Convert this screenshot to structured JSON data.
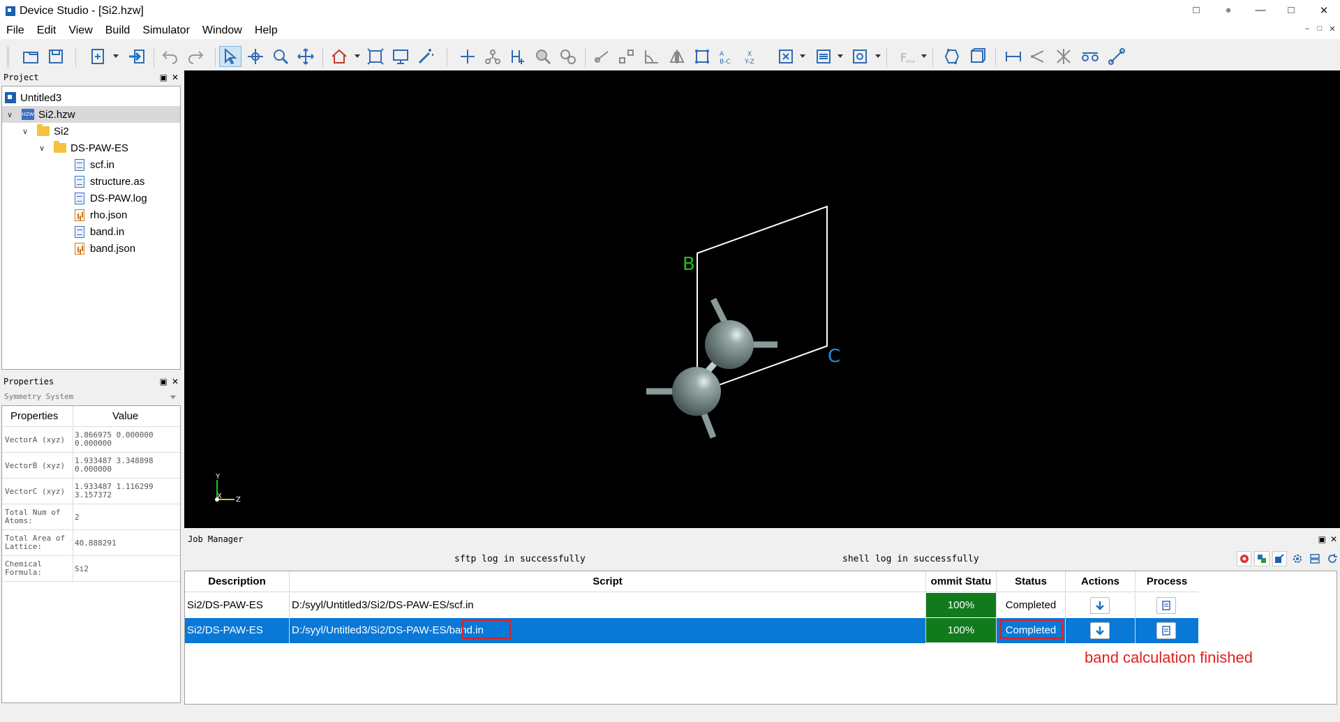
{
  "window": {
    "title": "Device Studio - [Si2.hzw]"
  },
  "menu": [
    "File",
    "Edit",
    "View",
    "Build",
    "Simulator",
    "Window",
    "Help"
  ],
  "project_panel": {
    "title": "Project",
    "tree": [
      {
        "label": "Untitled3",
        "icon": "project-icon"
      },
      {
        "label": "Si2.hzw",
        "icon": "hzw-file-icon"
      },
      {
        "label": "Si2",
        "icon": "folder-icon"
      },
      {
        "label": "DS-PAW-ES",
        "icon": "folder-icon"
      },
      {
        "label": "scf.in",
        "icon": "text-file-icon"
      },
      {
        "label": "structure.as",
        "icon": "text-file-icon"
      },
      {
        "label": "DS-PAW.log",
        "icon": "text-file-icon"
      },
      {
        "label": "rho.json",
        "icon": "chart-file-icon"
      },
      {
        "label": "band.in",
        "icon": "text-file-icon"
      },
      {
        "label": "band.json",
        "icon": "chart-file-icon"
      }
    ]
  },
  "properties_panel": {
    "title": "Properties",
    "combo": "Symmetry System",
    "header_key": "Properties",
    "header_value": "Value",
    "rows": [
      {
        "key": "VectorA (xyz)",
        "value": "3.866975 0.000000 0.000000"
      },
      {
        "key": "VectorB (xyz)",
        "value": "1.933487 3.348898 0.000000"
      },
      {
        "key": "VectorC (xyz)",
        "value": "1.933487 1.116299 3.157372"
      },
      {
        "key": "Total Num of Atoms:",
        "value": "2"
      },
      {
        "key": "Total Area of Lattice:",
        "value": "40.888291"
      },
      {
        "key": "Chemical Formula:",
        "value": "Si2"
      }
    ]
  },
  "viewport": {
    "labels": {
      "b": "B",
      "c": "C"
    },
    "axis_labels": {
      "y": "Y",
      "x": "X",
      "z": "Z"
    },
    "colors": {
      "background": "#000000",
      "b_label": "#1fbf1f",
      "c_label": "#1a8fe0",
      "atom": "#8a9a9a"
    }
  },
  "job_manager": {
    "title": "Job Manager",
    "messages": [
      "sftp log in successfully",
      "shell log in successfully"
    ],
    "columns": [
      "Description",
      "Script",
      "ommit Statu",
      "Status",
      "Actions",
      "Process"
    ],
    "rows": [
      {
        "description": "Si2/DS-PAW-ES",
        "script": "D:/syyl/Untitled3/Si2/DS-PAW-ES/scf.in",
        "submit": "100%",
        "status": "Completed",
        "selected": false
      },
      {
        "description": "Si2/DS-PAW-ES",
        "script_prefix": "D:/syyl/Untitled3/Si2/DS-PAW-ES/",
        "script_file": "band.in",
        "submit": "100%",
        "status": "Completed",
        "selected": true
      }
    ],
    "annotation": "band calculation finished"
  },
  "colors": {
    "selection": "#0a78d7",
    "progress": "#117a1d",
    "annotation": "#e02020"
  }
}
